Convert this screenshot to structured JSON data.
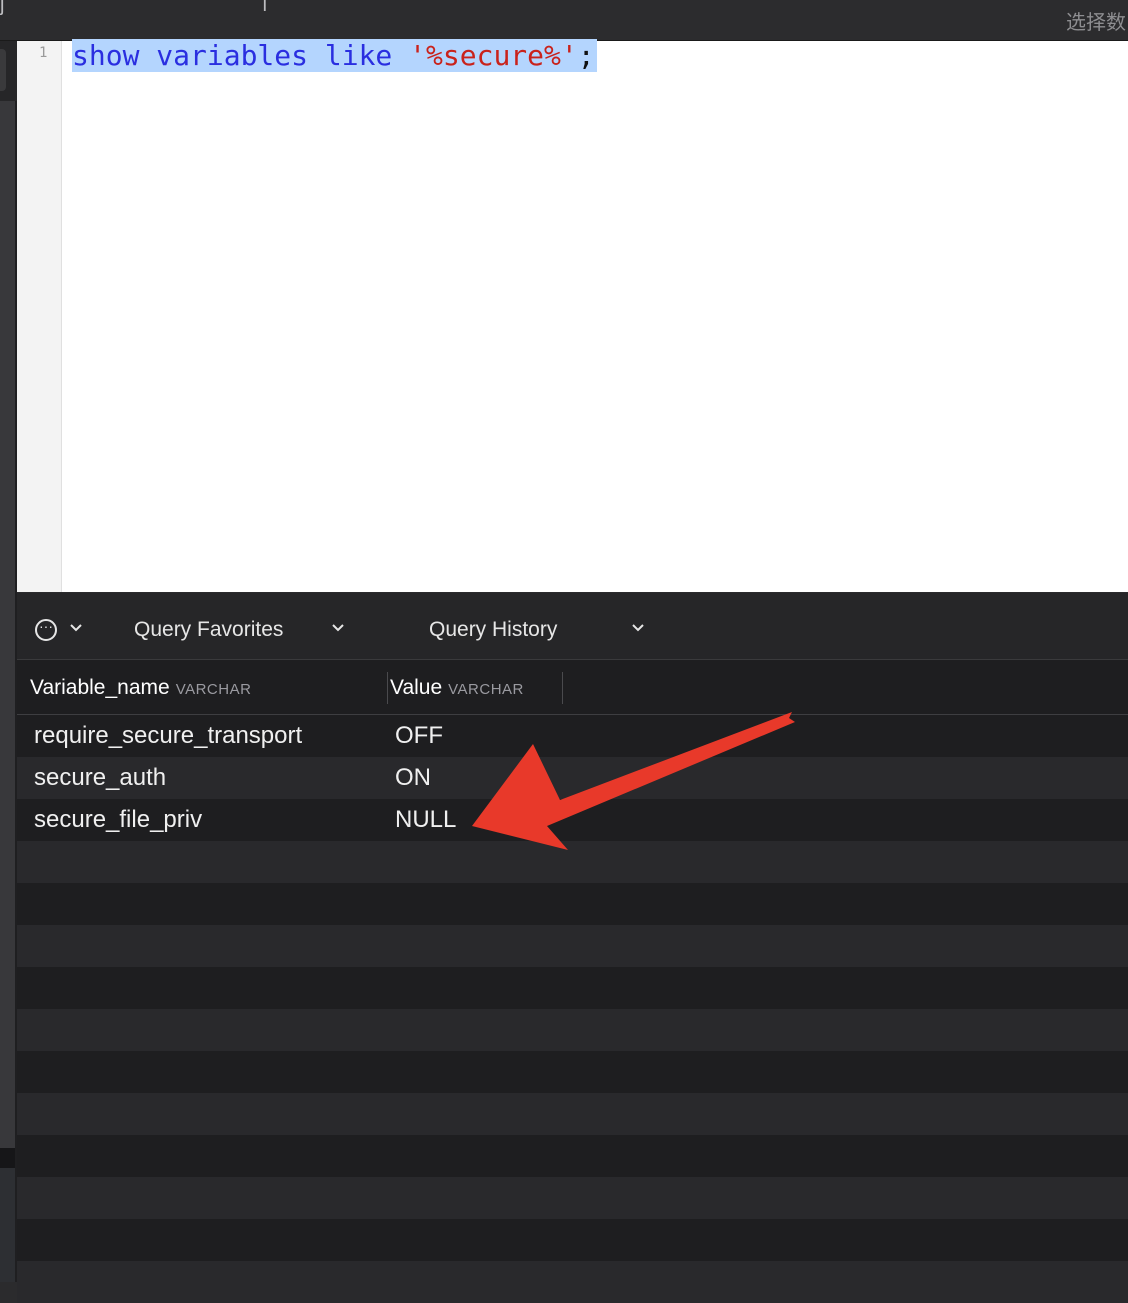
{
  "topbar": {
    "right_label": "选择数"
  },
  "editor": {
    "line_number": "1",
    "code": {
      "kw": "show variables like",
      "str": "'%secure%'",
      "punc": ";"
    }
  },
  "toolbar": {
    "favorites_label": "Query Favorites",
    "history_label": "Query History"
  },
  "results": {
    "columns": [
      {
        "name": "Variable_name",
        "type": "VARCHAR"
      },
      {
        "name": "Value",
        "type": "VARCHAR"
      }
    ],
    "rows": [
      [
        "require_secure_transport",
        "OFF"
      ],
      [
        "secure_auth",
        "ON"
      ],
      [
        "secure_file_priv",
        "NULL"
      ]
    ]
  },
  "colors": {
    "annotation_arrow": "#e8392a",
    "keyword": "#2a2ee0",
    "string": "#c9221b",
    "selection": "#b4d5fe"
  },
  "icons": [
    "more-options-icon",
    "chevron-down-icon"
  ]
}
